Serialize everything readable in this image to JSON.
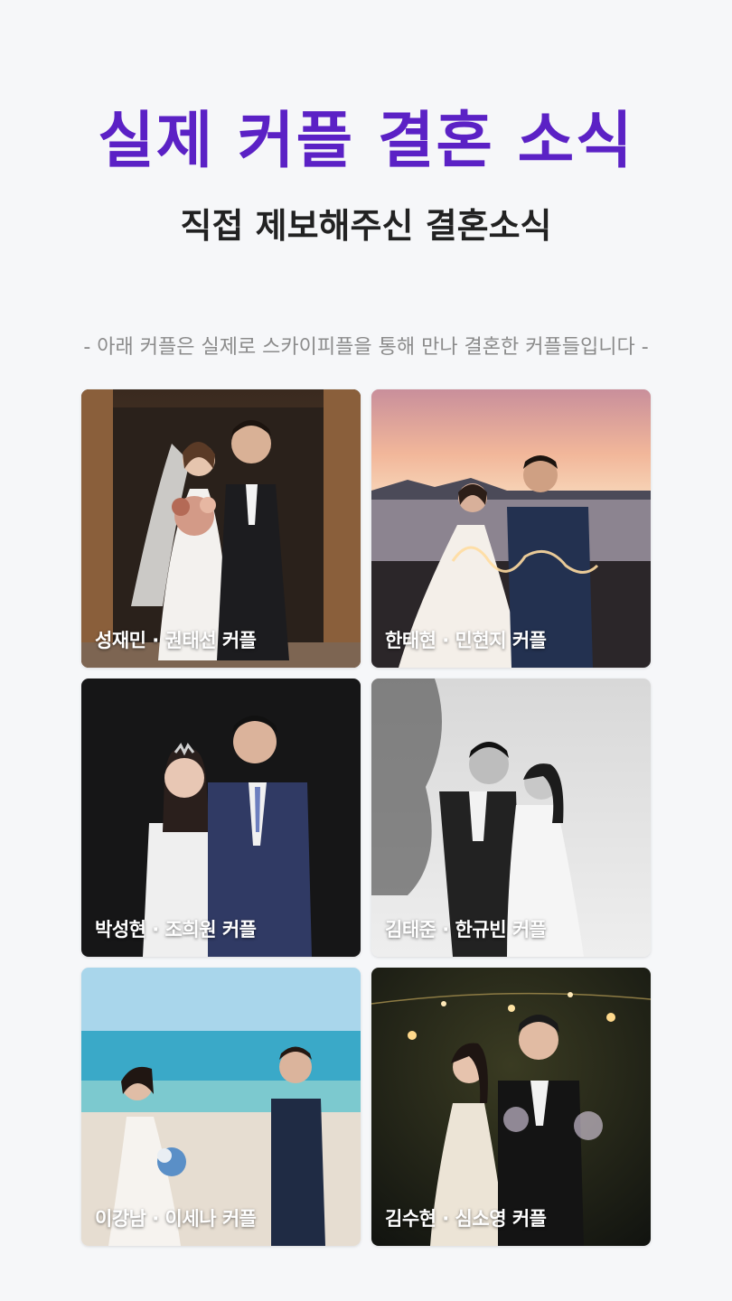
{
  "header": {
    "title": "실제 커플 결혼 소식",
    "subtitle": "직접 제보해주신 결혼소식",
    "note": "- 아래 커플은 실제로 스카이피플을 통해 만나 결혼한 커플들입니다 -"
  },
  "colors": {
    "accent": "#5b21c5",
    "background": "#f6f7f9"
  },
  "couples": [
    {
      "label": "성재민 · 권태선 커플"
    },
    {
      "label": "한태현 · 민현지  커플"
    },
    {
      "label": "박성현 · 조희원  커플"
    },
    {
      "label": "김태준 · 한규빈  커플"
    },
    {
      "label": "이강남 · 이세나  커플"
    },
    {
      "label": "김수현 · 심소영  커플"
    }
  ]
}
